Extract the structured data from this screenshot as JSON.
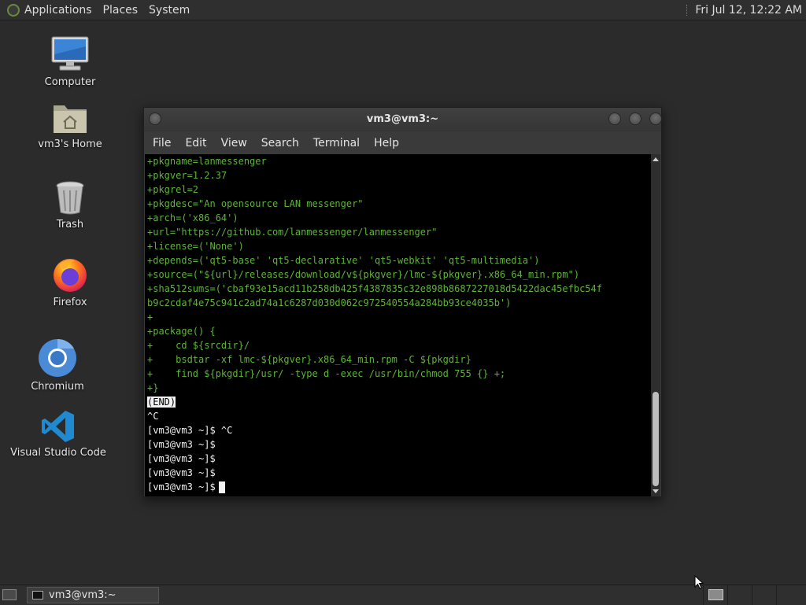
{
  "top_panel": {
    "menus": [
      "Applications",
      "Places",
      "System"
    ],
    "clock": "Fri Jul 12, 12:22 AM"
  },
  "desktop": {
    "icons": [
      {
        "label": "Computer",
        "icon": "computer-icon"
      },
      {
        "label": "vm3's Home",
        "icon": "home-folder-icon"
      },
      {
        "label": "Trash",
        "icon": "trash-icon"
      },
      {
        "label": "Firefox",
        "icon": "firefox-icon"
      },
      {
        "label": "Chromium",
        "icon": "chromium-icon"
      },
      {
        "label": "Visual Studio Code",
        "icon": "vscode-icon"
      }
    ]
  },
  "terminal": {
    "title": "vm3@vm3:~",
    "menu": [
      "File",
      "Edit",
      "View",
      "Search",
      "Terminal",
      "Help"
    ],
    "lines": [
      "+pkgname=lanmessenger",
      "+pkgver=1.2.37",
      "+pkgrel=2",
      "+pkgdesc=\"An opensource LAN messenger\"",
      "+arch=('x86_64')",
      "+url=\"https://github.com/lanmessenger/lanmessenger\"",
      "+license=('None')",
      "+depends=('qt5-base' 'qt5-declarative' 'qt5-webkit' 'qt5-multimedia')",
      "+source=(\"${url}/releases/download/v${pkgver}/lmc-${pkgver}.x86_64_min.rpm\")",
      "+sha512sums=('cbaf93e15acd11b258db425f4387835c32e898b8687227018d5422dac45efbc54f",
      "b9c2cdaf4e75c941c2ad74a1c6287d030d062c972540554a284bb93ce4035b')",
      "+",
      "+package() {",
      "+    cd ${srcdir}/",
      "+    bsdtar -xf lmc-${pkgver}.x86_64_min.rpm -C ${pkgdir}",
      "+    find ${pkgdir}/usr/ -type d -exec /usr/bin/chmod 755 {} +;",
      "+}"
    ],
    "end_marker": "(END)",
    "output_lines": [
      "^C",
      "[vm3@vm3 ~]$ ^C",
      "[vm3@vm3 ~]$",
      "[vm3@vm3 ~]$",
      "[vm3@vm3 ~]$"
    ],
    "prompt": "[vm3@vm3 ~]$"
  },
  "taskbar": {
    "window_label": "vm3@vm3:~"
  },
  "colors": {
    "terminal_text_green": "#5fb33a",
    "terminal_bg": "#000000",
    "panel_bg": "#2f2f2f",
    "desktop_bg": "#2b2b2b"
  }
}
